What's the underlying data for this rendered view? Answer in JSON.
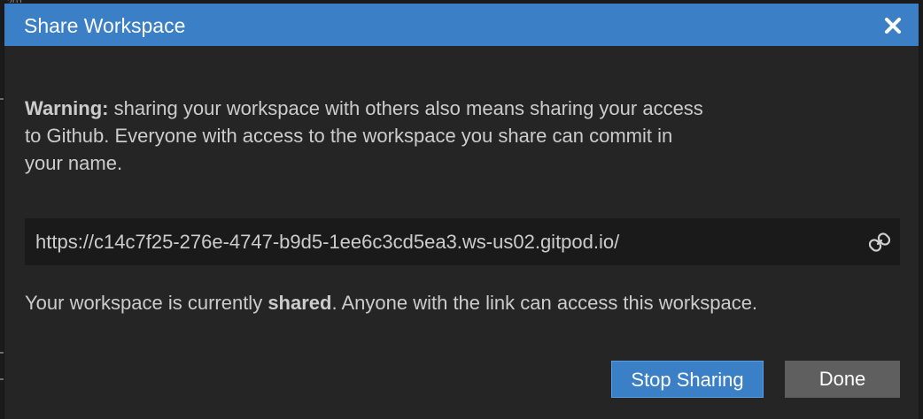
{
  "backdrop": {
    "top_fragment": "201"
  },
  "dialog": {
    "title": "Share Workspace",
    "close_icon": "close-icon",
    "warning": {
      "label": "Warning:",
      "text": " sharing your workspace with others also means sharing your access to Github. Everyone with access to the workspace you share can commit in your name."
    },
    "share_url": "https://c14c7f25-276e-4747-b9d5-1ee6c3cd5ea3.ws-us02.gitpod.io/",
    "copy_icon": "link-icon",
    "status": {
      "prefix": "Your workspace is currently ",
      "state": "shared",
      "suffix": ". Anyone with the link can access this workspace."
    },
    "buttons": {
      "primary": "Stop Sharing",
      "secondary": "Done"
    }
  },
  "colors": {
    "titlebar": "#3b7fc6",
    "dialog_bg": "#252526",
    "url_bg": "#1a1a1a",
    "text": "#cccccc",
    "primary_button": "#3b7fc6",
    "secondary_button": "#5f5f5f"
  }
}
